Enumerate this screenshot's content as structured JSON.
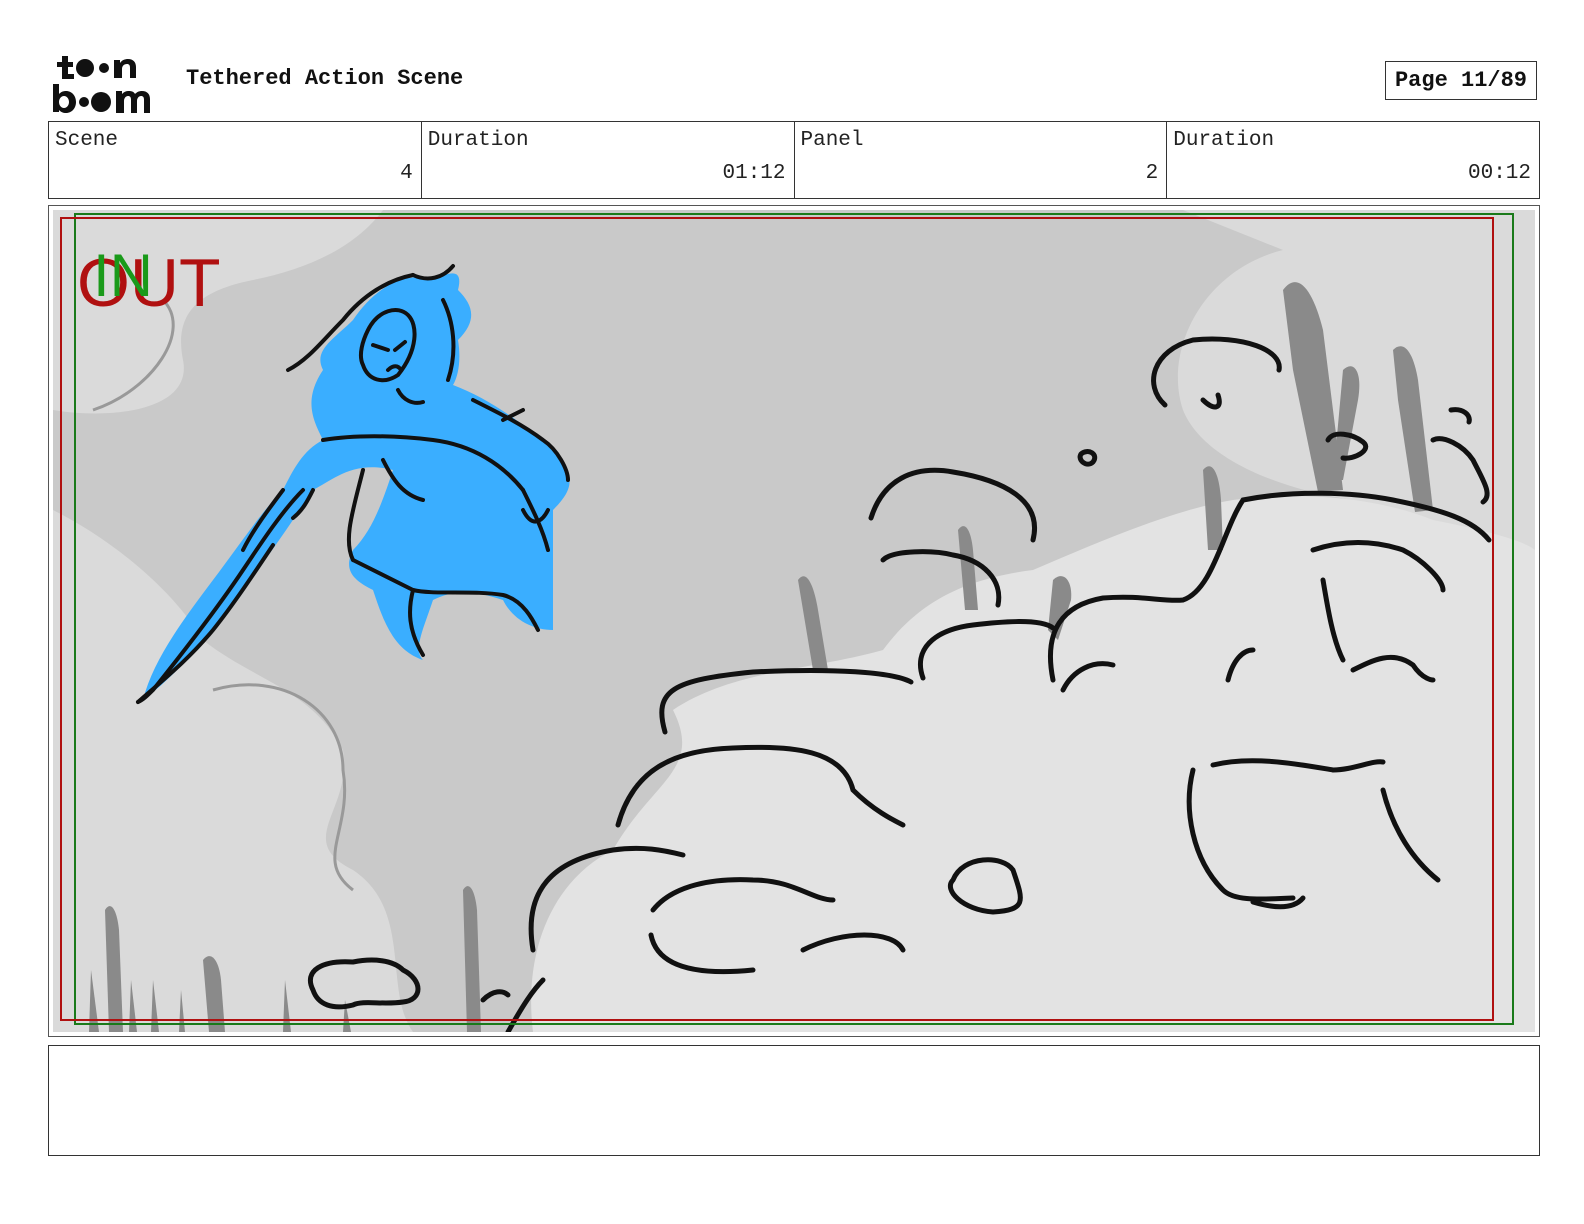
{
  "header": {
    "logo_text": "toon boom",
    "title": "Tethered Action Scene",
    "page": "Page 11/89"
  },
  "info": [
    {
      "label": "Scene",
      "value": "4"
    },
    {
      "label": "Duration",
      "value": "01:12"
    },
    {
      "label": "Panel",
      "value": "2"
    },
    {
      "label": "Duration",
      "value": "00:12"
    }
  ],
  "panel": {
    "in_marker": "IN",
    "out_marker": "OUT",
    "in_color": "#1a9a1a",
    "out_color": "#b01010",
    "character_color": "#3aaeff"
  },
  "notes": {
    "text": ""
  }
}
